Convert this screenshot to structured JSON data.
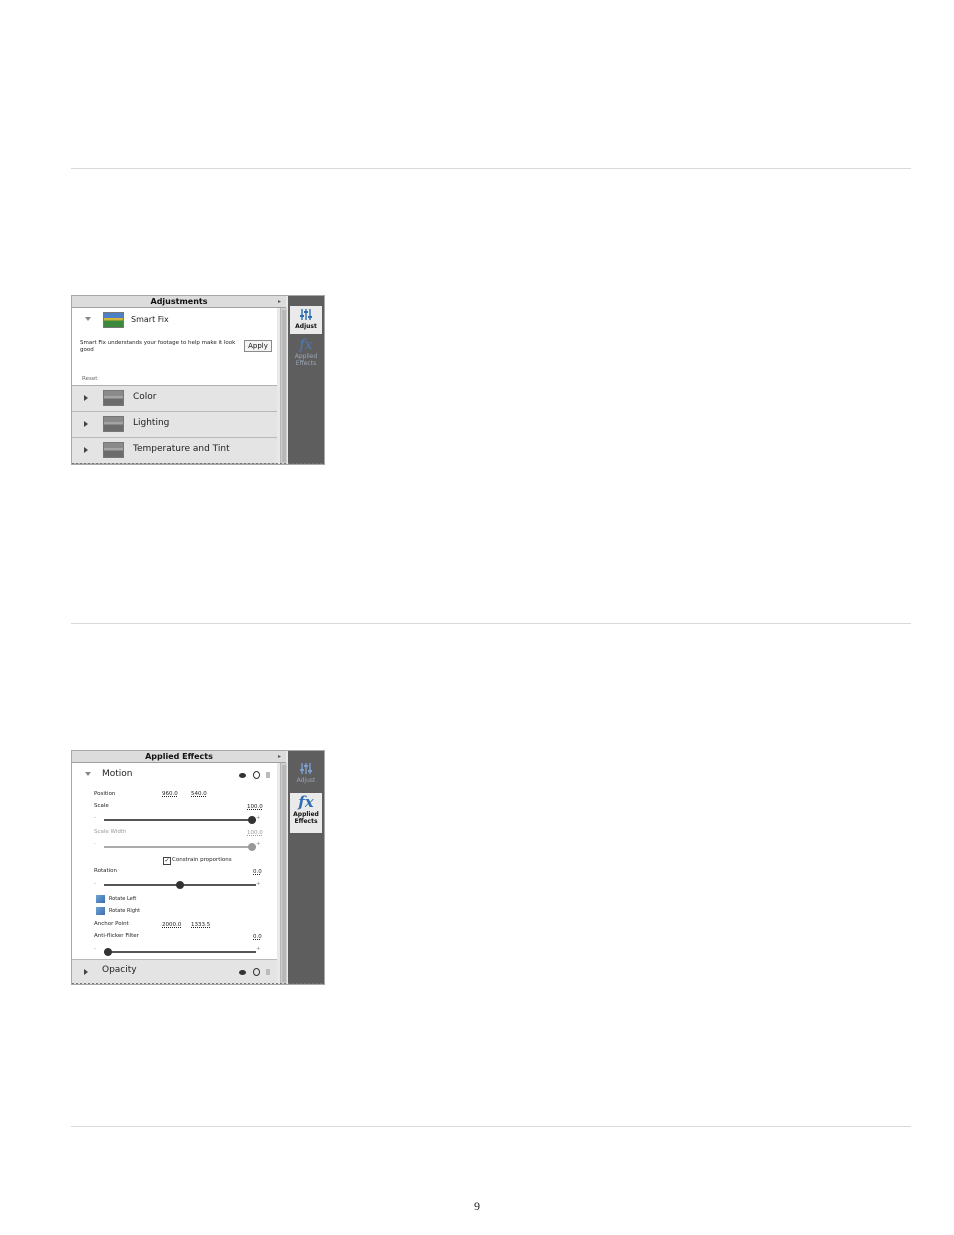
{
  "panel1": {
    "title": "Adjustments",
    "side_tabs": [
      {
        "label": "Adjust",
        "icon": "sliders-icon"
      },
      {
        "label": "Applied Effects",
        "icon": "fx-icon"
      }
    ],
    "smart_fix": {
      "label": "Smart Fix",
      "description": "Smart Fix understands your footage to help make it look good",
      "apply_label": "Apply",
      "reset_label": "Reset"
    },
    "rows": [
      {
        "label": "Color"
      },
      {
        "label": "Lighting"
      },
      {
        "label": "Temperature and Tint"
      }
    ]
  },
  "panel2": {
    "title": "Applied Effects",
    "side_tabs": [
      {
        "label": "Adjust",
        "icon": "sliders-icon"
      },
      {
        "label": "Applied Effects",
        "icon": "fx-icon"
      }
    ],
    "motion": {
      "label": "Motion",
      "position_label": "Position",
      "position_x": "960.0",
      "position_y": "540.0",
      "scale_label": "Scale",
      "scale_value": "100.0",
      "scale_level": 1.0,
      "scale_width_label": "Scale Width",
      "scale_width_value": "100.0",
      "scale_width_level": 1.0,
      "constrain_label": "Constrain proportions",
      "constrain_checked": true,
      "rotation_label": "Rotation",
      "rotation_value": "0.0",
      "rotation_level": 0.5,
      "rotate_left_label": "Rotate Left",
      "rotate_right_label": "Rotate Right",
      "anchor_label": "Anchor Point",
      "anchor_x": "2000.0",
      "anchor_y": "1333.5",
      "antiflicker_label": "Anti-flicker Filter",
      "antiflicker_value": "0.0",
      "antiflicker_level": 0.0
    },
    "opacity_label": "Opacity"
  },
  "page_number": "9"
}
